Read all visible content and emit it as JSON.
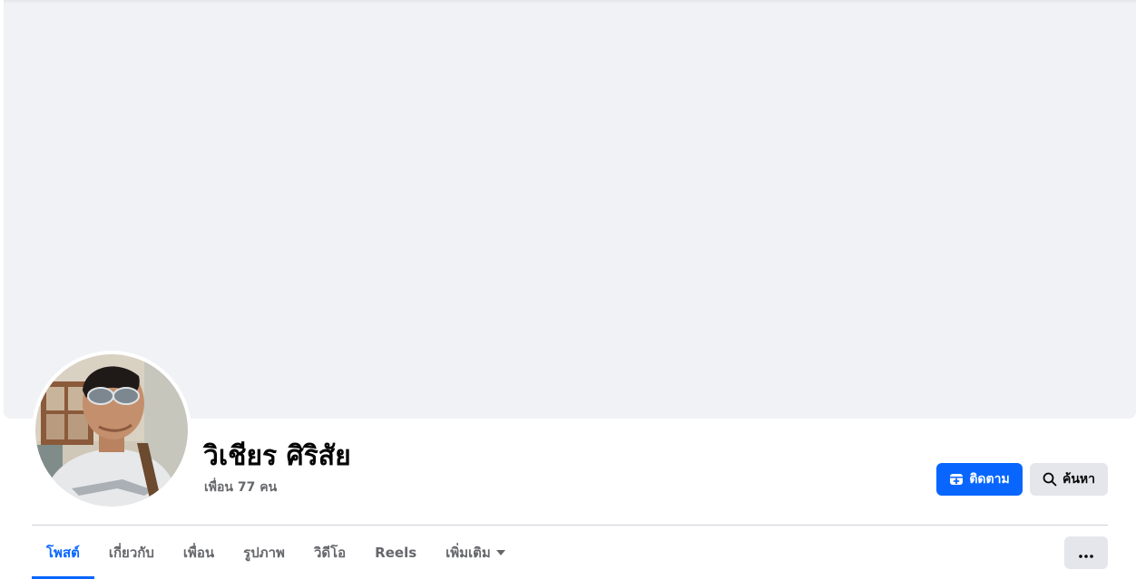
{
  "profile": {
    "name": "วิเชียร ศิริสัย",
    "friends": "เพื่อน 77 คน"
  },
  "actions": {
    "follow_label": "ติดตาม",
    "search_label": "ค้นหา"
  },
  "tabs": [
    {
      "label": "โพสต์",
      "active": true
    },
    {
      "label": "เกี่ยวกับ"
    },
    {
      "label": "เพื่อน"
    },
    {
      "label": "รูปภาพ"
    },
    {
      "label": "วิดีโอ"
    },
    {
      "label": "Reels"
    },
    {
      "label": "เพิ่มเติม"
    }
  ],
  "icons": {
    "follow": "follow-plus-icon",
    "search": "search-icon",
    "more_tab": "caret-down-icon",
    "more_menu": "more-horizontal-icon"
  },
  "colors": {
    "accent": "#0866ff",
    "cover": "#f0f2f5",
    "secondary_button": "#e4e6eb",
    "muted_text": "#65676b"
  }
}
